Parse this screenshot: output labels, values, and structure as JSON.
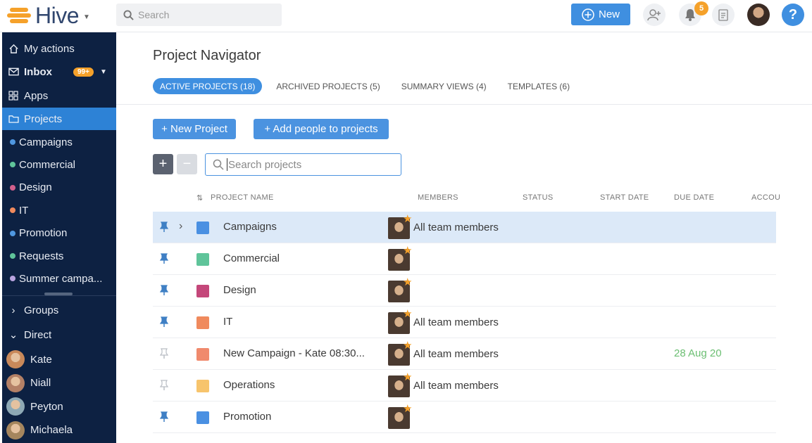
{
  "app": {
    "brand": "Hive",
    "search_placeholder": "Search",
    "new_label": "New",
    "notification_count": "5",
    "help_label": "?"
  },
  "sidebar": {
    "nav": [
      {
        "label": "My actions",
        "icon": "home-icon"
      },
      {
        "label": "Inbox",
        "icon": "mail-icon",
        "badge": "99+"
      },
      {
        "label": "Apps",
        "icon": "grid-icon"
      },
      {
        "label": "Projects",
        "icon": "folder-icon",
        "active": true
      }
    ],
    "projects": [
      {
        "label": "Campaigns",
        "color": "#4f97e0"
      },
      {
        "label": "Commercial",
        "color": "#5fc49a"
      },
      {
        "label": "Design",
        "color": "#d1608c"
      },
      {
        "label": "IT",
        "color": "#f08a5d"
      },
      {
        "label": "Promotion",
        "color": "#4f97e0"
      },
      {
        "label": "Requests",
        "color": "#5fc49a"
      },
      {
        "label": "Summer campa...",
        "color": "#b9a4e0"
      }
    ],
    "groups_label": "Groups",
    "direct_label": "Direct",
    "people": [
      {
        "name": "Kate"
      },
      {
        "name": "Niall"
      },
      {
        "name": "Peyton"
      },
      {
        "name": "Michaela"
      }
    ]
  },
  "main": {
    "title": "Project Navigator",
    "tabs": [
      {
        "label": "ACTIVE PROJECTS (18)",
        "active": true
      },
      {
        "label": "ARCHIVED PROJECTS (5)"
      },
      {
        "label": "SUMMARY VIEWS (4)"
      },
      {
        "label": "TEMPLATES (6)"
      }
    ],
    "new_project_label": "+ New Project",
    "add_people_label": "+ Add people to projects",
    "expand_label": "+",
    "collapse_label": "−",
    "search_placeholder": "Search projects",
    "columns": [
      "PROJECT NAME",
      "MEMBERS",
      "STATUS",
      "START DATE",
      "DUE DATE",
      "ACCOU"
    ],
    "rows": [
      {
        "name": "Campaigns",
        "color": "#4a90e2",
        "members": "All team members",
        "due": "",
        "pinned": true,
        "selected": true,
        "expandable": true
      },
      {
        "name": "Commercial",
        "color": "#5fc49a",
        "members": "",
        "due": "",
        "pinned": true
      },
      {
        "name": "Design",
        "color": "#c4477a",
        "members": "",
        "due": "",
        "pinned": true
      },
      {
        "name": "IT",
        "color": "#f08a5d",
        "members": "All team members",
        "due": "",
        "pinned": true
      },
      {
        "name": "New Campaign - Kate 08:30...",
        "color": "#f08a6d",
        "members": "All team members",
        "due": "28 Aug 20",
        "pinned": false
      },
      {
        "name": "Operations",
        "color": "#f7c46c",
        "members": "All team members",
        "due": "",
        "pinned": false
      },
      {
        "name": "Promotion",
        "color": "#4a90e2",
        "members": "",
        "due": "",
        "pinned": true
      }
    ]
  }
}
